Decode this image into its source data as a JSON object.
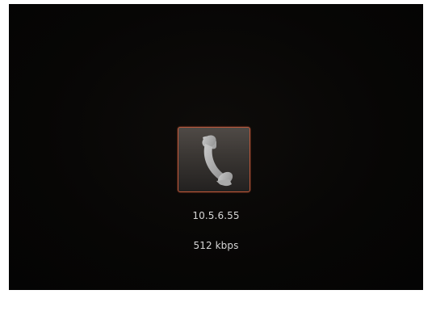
{
  "call": {
    "icon": "phone-handset-icon",
    "accent_color": "#c0583a"
  },
  "connection": {
    "ip_address": "10.5.6.55",
    "bitrate": "512 kbps"
  }
}
